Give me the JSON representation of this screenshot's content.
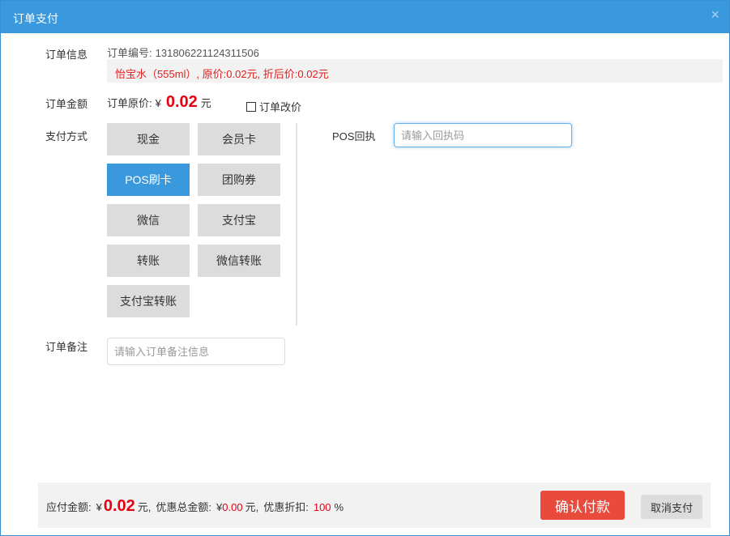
{
  "dialog": {
    "title": "订单支付",
    "close_icon": "close-icon",
    "close_glyph": "×"
  },
  "labels": {
    "order_info": "订单信息",
    "order_amount": "订单金额",
    "payment_method": "支付方式",
    "order_remark": "订单备注"
  },
  "order": {
    "number_label": "订单编号:",
    "number": "131806221124311506",
    "item_text": "怡宝水（555ml）, 原价:0.02元, 折后价:0.02元"
  },
  "amount": {
    "original_label": "订单原价:",
    "currency": "¥",
    "value": "0.02",
    "unit": "元",
    "change_price_label": "订单改价",
    "change_price_checked": false
  },
  "payment_methods": [
    {
      "label": "现金",
      "active": false
    },
    {
      "label": "会员卡",
      "active": false
    },
    {
      "label": "POS刷卡",
      "active": true
    },
    {
      "label": "团购券",
      "active": false
    },
    {
      "label": "微信",
      "active": false
    },
    {
      "label": "支付宝",
      "active": false
    },
    {
      "label": "转账",
      "active": false
    },
    {
      "label": "微信转账",
      "active": false
    },
    {
      "label": "支付宝转账",
      "active": false
    }
  ],
  "pos": {
    "label": "POS回执",
    "placeholder": "请输入回执码",
    "value": ""
  },
  "remark": {
    "placeholder": "请输入订单备注信息",
    "value": ""
  },
  "footer": {
    "payable_label": "应付金额:",
    "payable_currency": "¥",
    "payable_value": "0.02",
    "payable_unit": "元,",
    "discount_total_label": "优惠总金额:",
    "discount_total_currency": "¥",
    "discount_total_value": "0.00",
    "discount_total_unit": "元,",
    "discount_rate_label": "优惠折扣:",
    "discount_rate_value": "100",
    "discount_rate_unit": "%",
    "confirm_label": "确认付款",
    "cancel_label": "取消支付"
  },
  "colors": {
    "accent": "#3a98dd",
    "price_red": "#e60012",
    "confirm_red": "#e84a3c",
    "button_gray": "#dcdcdc"
  }
}
